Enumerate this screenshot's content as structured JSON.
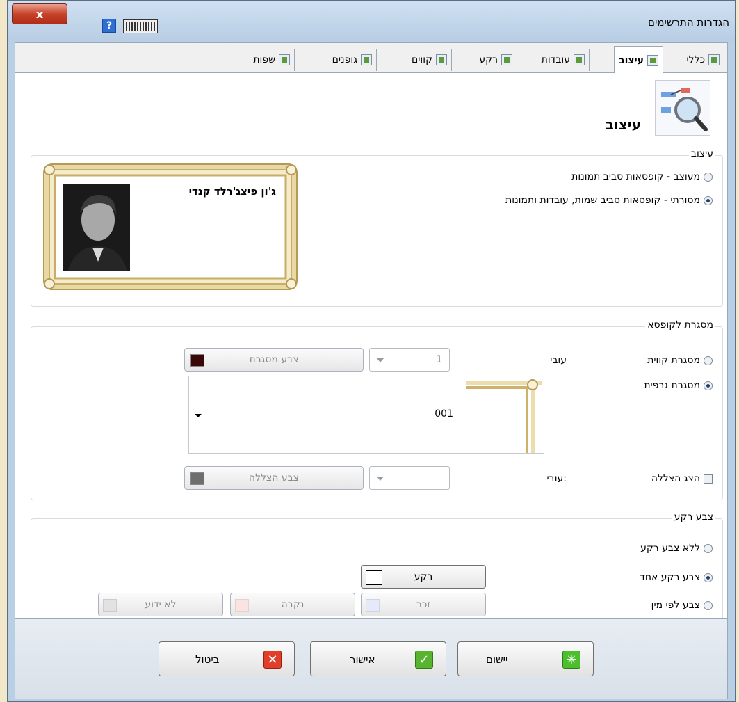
{
  "window": {
    "title": "הגדרות התרשימים",
    "close_label": "x"
  },
  "titlebar": {
    "help_label": "?"
  },
  "tabs": [
    {
      "label": "כללי",
      "icon": "settings-icon"
    },
    {
      "label": "עיצוב",
      "icon": "design-icon",
      "active": true
    },
    {
      "label": "עובדות",
      "icon": "facts-icon"
    },
    {
      "label": "רקע",
      "icon": "background-icon"
    },
    {
      "label": "קווים",
      "icon": "lines-icon"
    },
    {
      "label": "גופנים",
      "icon": "fonts-icon"
    },
    {
      "label": "שפות",
      "icon": "languages-icon"
    }
  ],
  "header": {
    "title": "עיצוב"
  },
  "design_group": {
    "legend": "עיצוב",
    "options": [
      {
        "label": "מעוצב - קופסאות סביב תמונות",
        "checked": false
      },
      {
        "label": "מסורתי - קופסאות סביב שמות, עובדות ותמונות",
        "checked": true
      }
    ],
    "preview_name": "ג'ון פיצג'רלד קנדי"
  },
  "box_frame_group": {
    "legend": "מסגרת לקופסא",
    "line_frame_label": "מסגרת קווית",
    "graphic_frame_label": "מסגרת גרפית",
    "thickness_label": "עובי",
    "thickness_value": "1",
    "frame_color_label": "צבע מסגרת",
    "frame_color": "#3a0808",
    "graphic_frame_value": "001",
    "show_shadow_label": "הצג הצללה",
    "shadow_thickness_label": "עובי:",
    "shadow_color_label": "צבע הצללה",
    "shadow_color": "#6e6e6e"
  },
  "bg_color_group": {
    "legend": "צבע רקע",
    "no_bg_label": "ללא צבע רקע",
    "single_bg_label": "צבע רקע אחד",
    "by_gender_label": "צבע לפי מין",
    "bg_button_label": "רקע",
    "male_label": "זכר",
    "female_label": "נקבה",
    "unknown_label": "לא ידוע",
    "male_color": "#e6e9f7",
    "female_color": "#f9e4e2",
    "unknown_color": "#e2e2e2"
  },
  "footer": {
    "apply_label": "יישום",
    "ok_label": "אישור",
    "cancel_label": "ביטול"
  }
}
